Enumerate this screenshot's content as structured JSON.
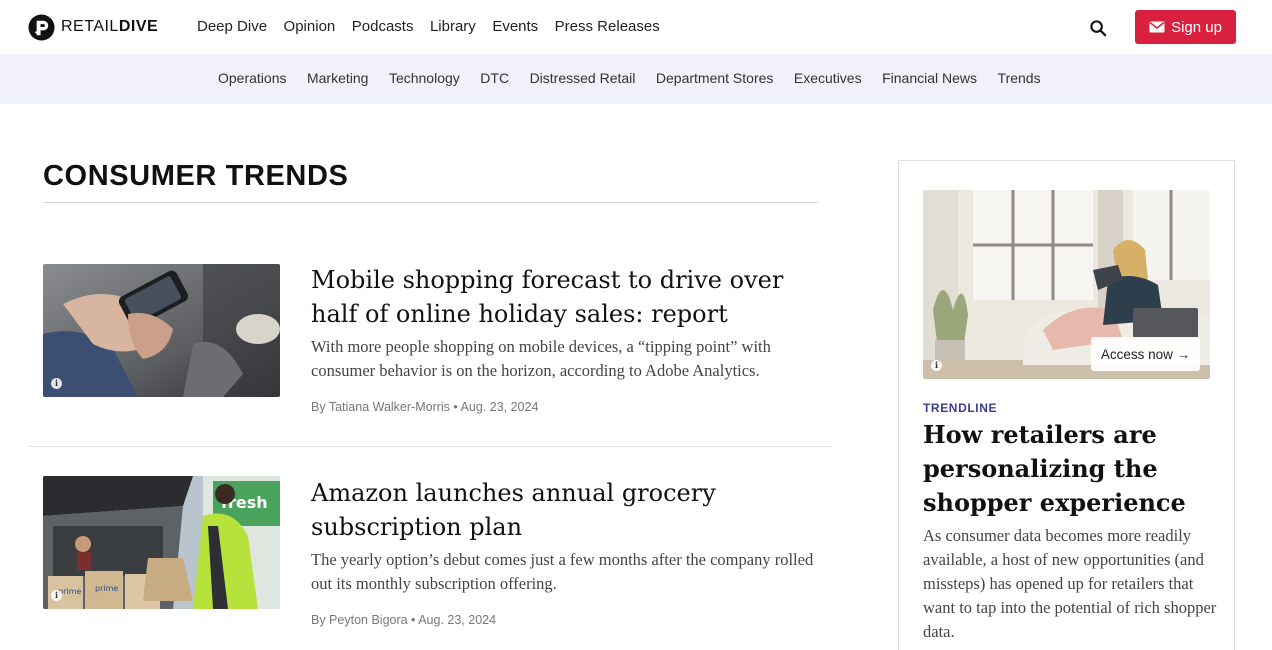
{
  "header": {
    "logo": {
      "thin": "RETAIL",
      "bold": "DIVE"
    },
    "nav": [
      "Deep Dive",
      "Opinion",
      "Podcasts",
      "Library",
      "Events",
      "Press Releases"
    ],
    "signup_label": "Sign up",
    "search_icon": "search-icon",
    "signup_icon": "envelope-icon",
    "accent_color": "#d9213f"
  },
  "subnav": {
    "items": [
      "Operations",
      "Marketing",
      "Technology",
      "DTC",
      "Distressed Retail",
      "Department Stores",
      "Executives",
      "Financial News",
      "Trends"
    ],
    "background": "#f1f1fb"
  },
  "section": {
    "title": "CONSUMER TRENDS"
  },
  "articles": [
    {
      "title": "Mobile shopping forecast to drive over half of online holiday sales: report",
      "description": " With more people shopping on mobile devices, a “tipping point” with consumer behavior is on the horizon, according to Adobe Analytics.",
      "byline": "By Tatiana Walker-Morris • Aug. 23, 2024",
      "image_icon": "info-icon"
    },
    {
      "title": "Amazon launches annual grocery subscription plan",
      "description": "The yearly option’s debut comes just a few months after the company rolled out its monthly subscription offering.",
      "byline": "By Peyton Bigora • Aug. 23, 2024",
      "image_icon": "info-icon"
    }
  ],
  "sidebar": {
    "access_label": "Access now →",
    "label": "TRENDLINE",
    "title": "How retailers are personalizing the shopper experience",
    "description": "As consumer data becomes more readily available, a host of new opportunities (and missteps) has opened up for retailers that want to tap into the potential of rich shopper data.",
    "label_color": "#3b3f8f"
  }
}
